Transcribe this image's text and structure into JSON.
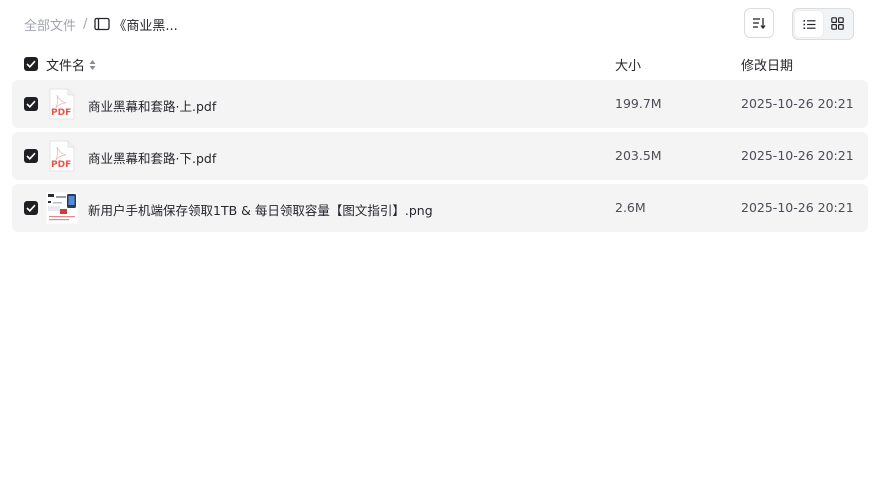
{
  "breadcrumb": {
    "root": "全部文件",
    "separator": "/",
    "current": "《商业黑..."
  },
  "toolbar": {
    "sort_icon": "sort-icon",
    "view_list_icon": "list-view-icon",
    "view_grid_icon": "grid-view-icon",
    "active_view": "list"
  },
  "table": {
    "headers": {
      "name": "文件名",
      "size": "大小",
      "date": "修改日期"
    },
    "all_selected": true,
    "rows": [
      {
        "name": "商业黑幕和套路·上.pdf",
        "size": "199.7M",
        "date": "2025-10-26 20:21",
        "type": "pdf",
        "selected": true
      },
      {
        "name": "商业黑幕和套路·下.pdf",
        "size": "203.5M",
        "date": "2025-10-26 20:21",
        "type": "pdf",
        "selected": true
      },
      {
        "name": "新用户手机端保存领取1TB & 每日领取容量【图文指引】.png",
        "size": "2.6M",
        "date": "2025-10-26 20:21",
        "type": "image",
        "selected": true
      }
    ]
  },
  "pdf_badge": "PDF",
  "colors": {
    "pdf_red": "#e5534b",
    "checkbox": "#1f2024",
    "row_bg": "#f4f4f5"
  }
}
